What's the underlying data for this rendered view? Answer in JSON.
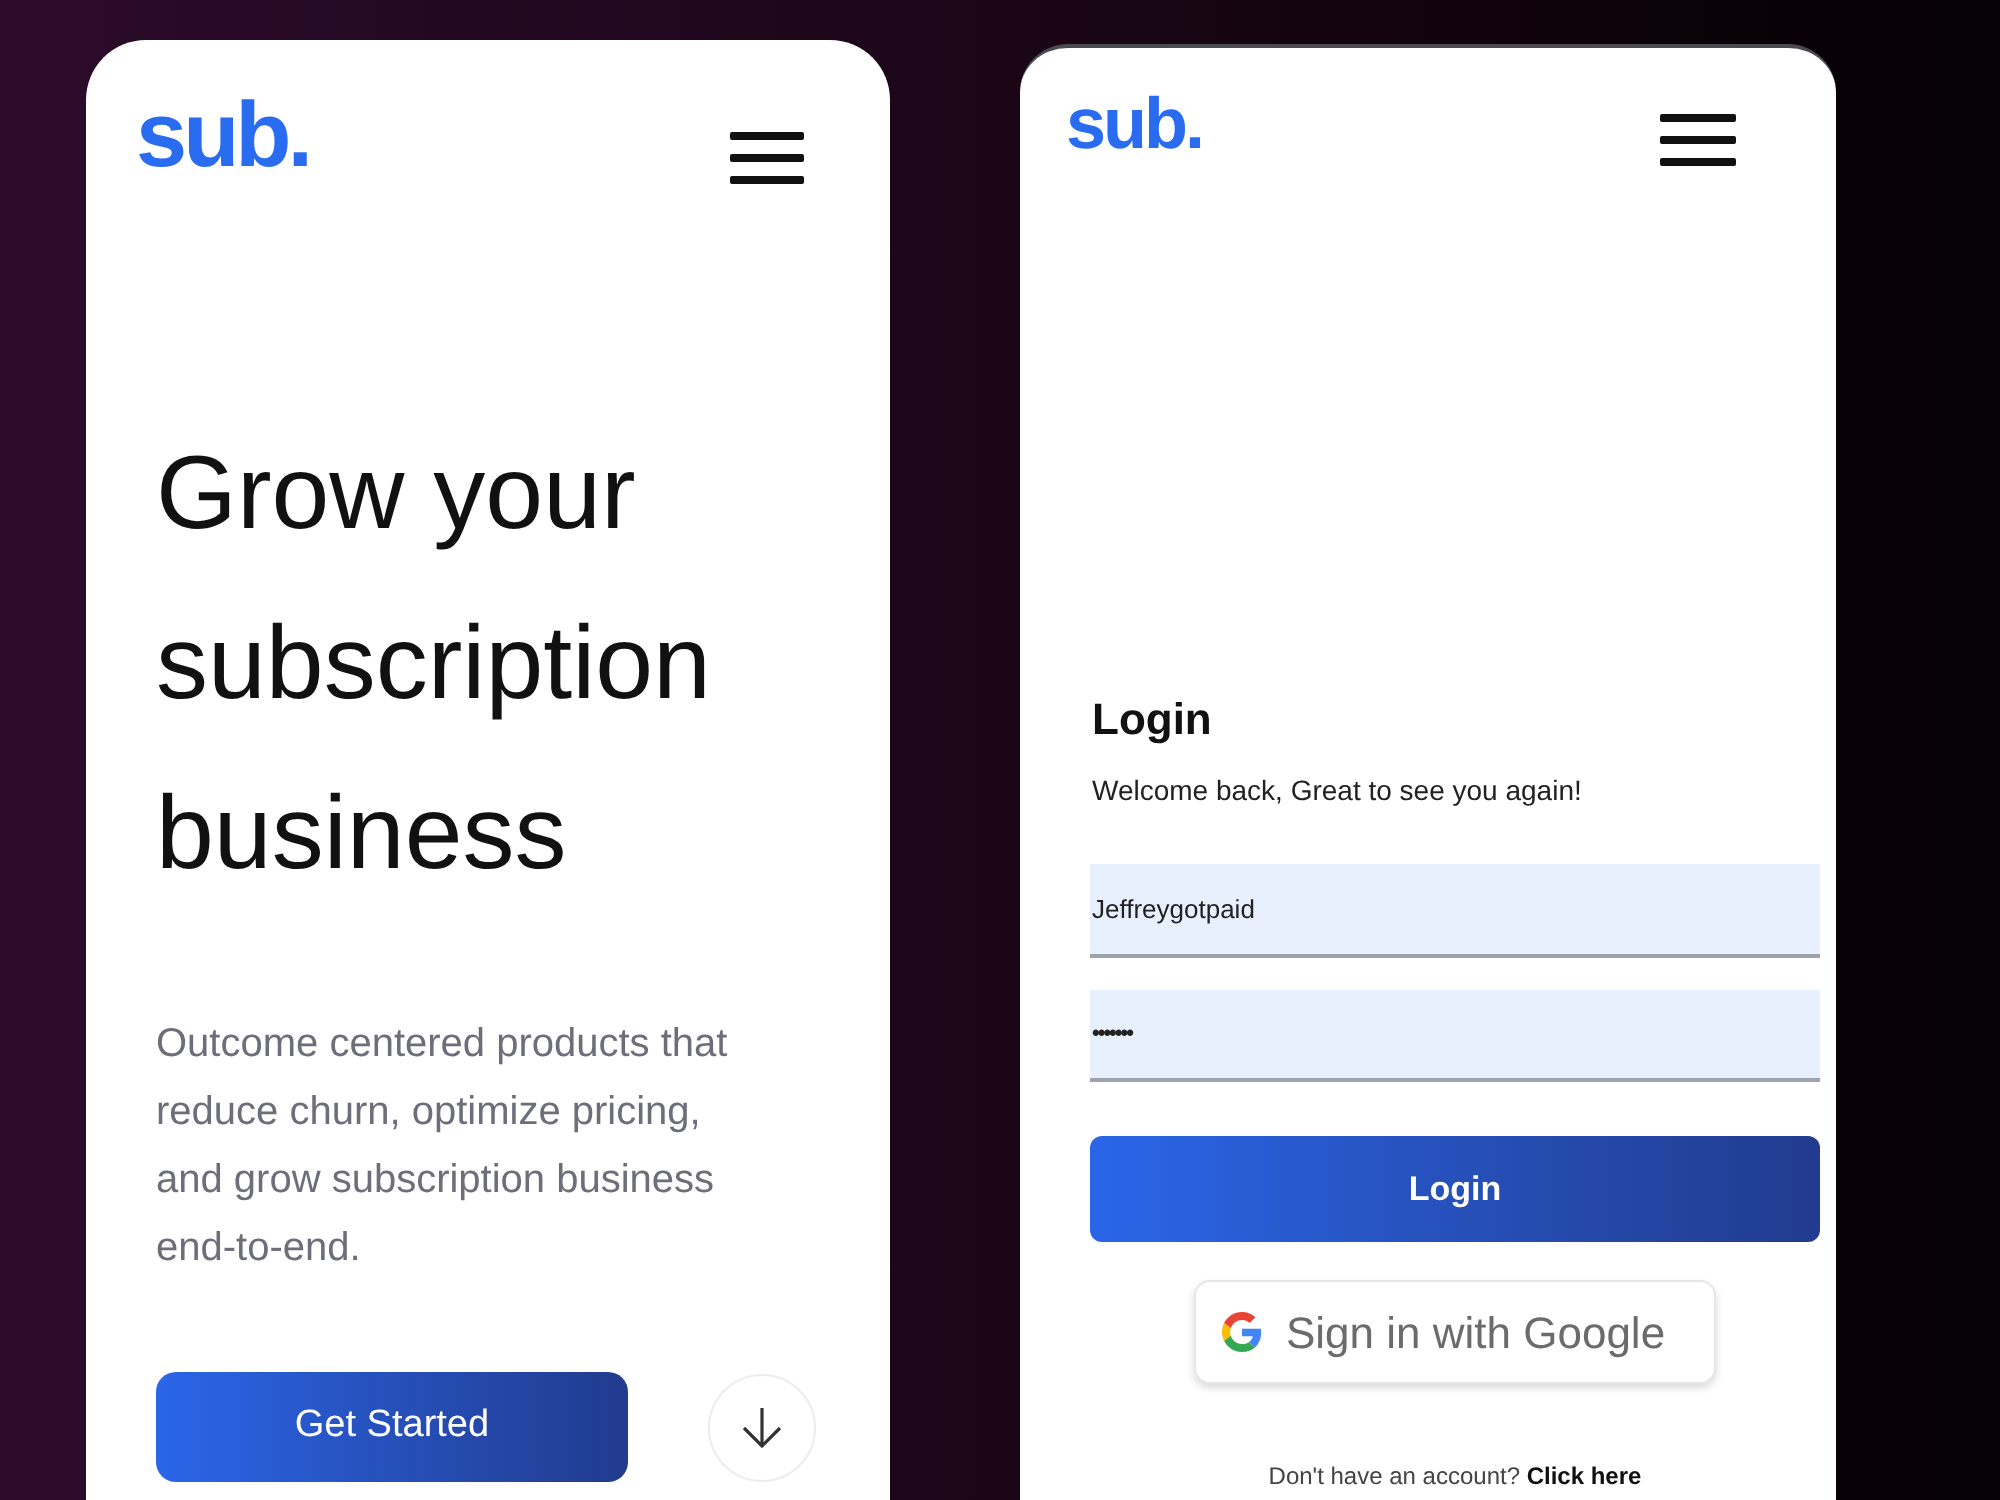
{
  "landing_screen": {
    "logo": "sub.",
    "headline": "Grow your subscription business",
    "description": "Outcome centered products that reduce churn, optimize pricing, and grow subscription business end-to-end.",
    "get_started_button": "Get Started"
  },
  "login_screen": {
    "logo": "sub.",
    "title": "Login",
    "subtitle": "Welcome back, Great to see you again!",
    "fields": [
      {
        "kind": "text",
        "value": "Jeffreygotpaid"
      },
      {
        "kind": "password",
        "value": "•••••••"
      }
    ],
    "login_button": "Login",
    "google_button": "Sign in with Google",
    "signup_prompt": "Don't have an account?",
    "signup_link": "Click here"
  }
}
